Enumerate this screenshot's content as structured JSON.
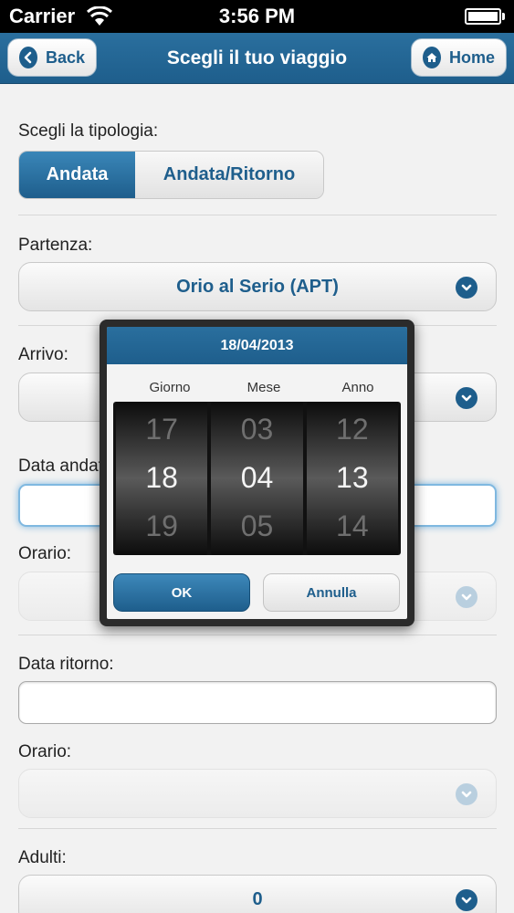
{
  "status_bar": {
    "carrier": "Carrier",
    "time": "3:56 PM"
  },
  "nav": {
    "title": "Scegli il tuo viaggio",
    "back_label": "Back",
    "home_label": "Home"
  },
  "form": {
    "type_label": "Scegli la tipologia:",
    "type_options": [
      "Andata",
      "Andata/Ritorno"
    ],
    "departure_label": "Partenza:",
    "departure_value": "Orio al Serio (APT)",
    "arrival_label": "Arrivo:",
    "arrival_value": "",
    "outbound_date_label": "Data andata:",
    "outbound_time_label": "Orario:",
    "return_date_label": "Data ritorno:",
    "return_date_value": "",
    "return_time_label": "Orario:",
    "adults_label": "Adulti:",
    "adults_value": "0"
  },
  "date_picker": {
    "title": "18/04/2013",
    "columns": [
      {
        "label": "Giorno",
        "prev": "17",
        "current": "18",
        "next": "19"
      },
      {
        "label": "Mese",
        "prev": "03",
        "current": "04",
        "next": "05"
      },
      {
        "label": "Anno",
        "prev": "12",
        "current": "13",
        "next": "14"
      }
    ],
    "ok_label": "OK",
    "cancel_label": "Annulla"
  },
  "colors": {
    "accent": "#1e5e8c",
    "background": "#f2f2f2"
  }
}
